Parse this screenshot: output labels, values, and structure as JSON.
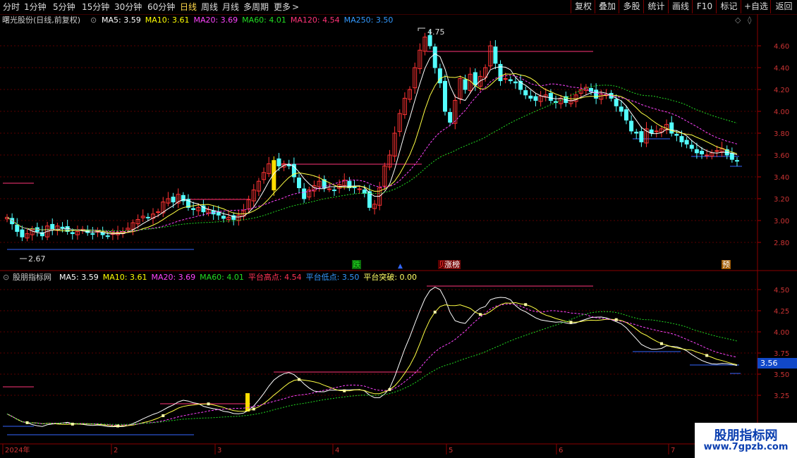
{
  "toolbar": {
    "periods": [
      "分时",
      "1分钟",
      "5分钟",
      "15分钟",
      "30分钟",
      "60分钟",
      "日线",
      "周线",
      "月线",
      "多周期",
      "更多"
    ],
    "active_period": "日线",
    "more_arrow": ">",
    "right_buttons": [
      "复权",
      "叠加",
      "多股",
      "统计",
      "画线",
      "F10",
      "标记",
      "+自选",
      "返回"
    ]
  },
  "main_panel": {
    "title": "曙光股份(日线,前复权)",
    "ma_legend": [
      {
        "label": "MA5:",
        "value": "3.59",
        "color": "#ffffff"
      },
      {
        "label": "MA10:",
        "value": "3.61",
        "color": "#ffff00"
      },
      {
        "label": "MA20:",
        "value": "3.69",
        "color": "#ff44ff"
      },
      {
        "label": "MA60:",
        "value": "4.01",
        "color": "#22dd22"
      },
      {
        "label": "MA120:",
        "value": "4.54",
        "color": "#ff3377"
      },
      {
        "label": "MA250:",
        "value": "3.50",
        "color": "#3399ff"
      }
    ],
    "y_ticks": [
      "4.60",
      "4.40",
      "4.20",
      "4.00",
      "3.80",
      "3.60",
      "3.40",
      "3.20",
      "3.00",
      "2.80"
    ],
    "high_label": "4.75",
    "low_label": "2.67",
    "markers": [
      {
        "text": "跌",
        "color": "#22dd22"
      },
      {
        "text": "贝",
        "color": "#ff3333"
      },
      {
        "text": "涨榜",
        "color": "#ffffff"
      },
      {
        "text": "预",
        "color": "#ffffff"
      }
    ],
    "marker_arrow": "▲"
  },
  "indicator_panel": {
    "title": "股朋指标网",
    "legend": [
      {
        "label": "MA5:",
        "value": "3.59",
        "color": "#ffffff"
      },
      {
        "label": "MA10:",
        "value": "3.61",
        "color": "#ffff00"
      },
      {
        "label": "MA20:",
        "value": "3.69",
        "color": "#ff44ff"
      },
      {
        "label": "MA60:",
        "value": "4.01",
        "color": "#22dd22"
      },
      {
        "label": "平台高点:",
        "value": "4.54",
        "color": "#ff3355"
      },
      {
        "label": "平台低点:",
        "value": "3.50",
        "color": "#3399ff"
      },
      {
        "label": "平台突破:",
        "value": "0.00",
        "color": "#ffff66"
      }
    ],
    "y_ticks": [
      "4.50",
      "4.25",
      "4.00",
      "3.75",
      "3.50",
      "3.25"
    ],
    "current_value": "3.56"
  },
  "date_axis": [
    "2024年",
    "2",
    "3",
    "4",
    "5",
    "6",
    "7"
  ],
  "watermark": {
    "title": "股朋指标网",
    "url": "www.7gpzb.com"
  },
  "colors": {
    "up": "#ff3333",
    "down": "#54ffff",
    "bg": "#000000",
    "grid": "#7a0000",
    "ma60": "#22dd22",
    "ma20": "#ff44ff",
    "ma10": "#ffff44",
    "ma5": "#ffffff",
    "platform_high": "#ff3377",
    "platform_low": "#3366ff"
  }
}
